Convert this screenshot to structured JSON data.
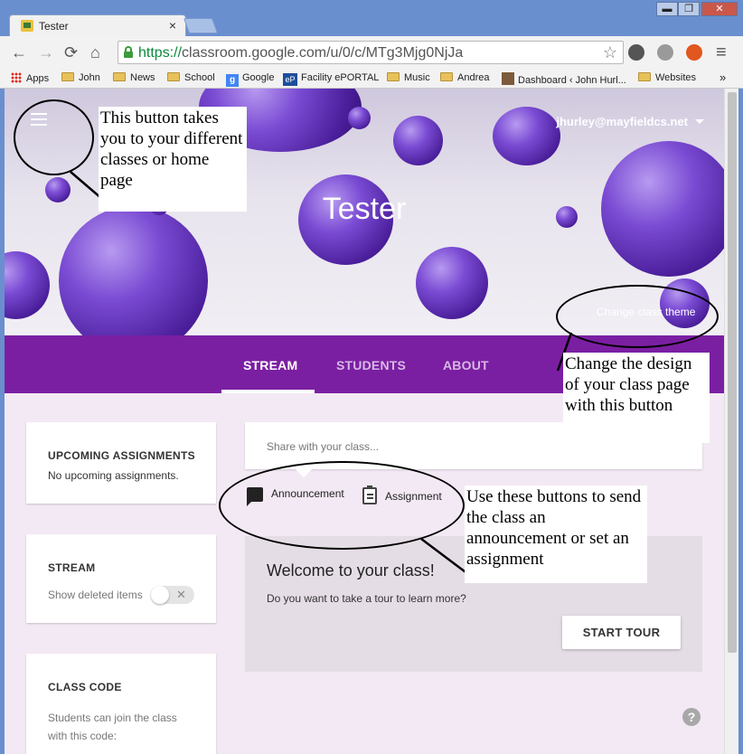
{
  "browser": {
    "tab_title": "Tester",
    "tab_close": "×",
    "url_scheme": "https://",
    "url_rest": "classroom.google.com/u/0/c/MTg3Mjg0NjJa",
    "window_minimize": "▬",
    "window_maximize": "❐",
    "window_close": "✕",
    "back_icon": "←",
    "forward_icon": "→",
    "reload_icon": "⟳",
    "home_icon": "⌂",
    "star_icon": "☆",
    "menu_icon": "≡",
    "bookmarks_overflow": "»"
  },
  "bookmarks": [
    {
      "label": "Apps",
      "icon": "apps-grid-icon"
    },
    {
      "label": "John",
      "icon": "folder-icon"
    },
    {
      "label": "News",
      "icon": "folder-icon"
    },
    {
      "label": "School",
      "icon": "folder-icon"
    },
    {
      "label": "Google",
      "icon": "google-icon",
      "icon_text": "g"
    },
    {
      "label": "Facility ePORTAL",
      "icon": "eportal-icon",
      "icon_text": "eP"
    },
    {
      "label": "Music",
      "icon": "folder-icon"
    },
    {
      "label": "Andrea",
      "icon": "folder-icon"
    },
    {
      "label": "Dashboard ‹ John Hurl...",
      "icon": "dashboard-icon"
    },
    {
      "label": "Websites",
      "icon": "folder-icon"
    }
  ],
  "header": {
    "account": "jhurley@mayfieldcs.net",
    "class_title": "Tester",
    "change_theme": "Change class theme"
  },
  "nav_tabs": [
    {
      "label": "STREAM",
      "active": true
    },
    {
      "label": "STUDENTS",
      "active": false
    },
    {
      "label": "ABOUT",
      "active": false
    }
  ],
  "sidebar": {
    "upcoming_title": "UPCOMING ASSIGNMENTS",
    "upcoming_text": "No upcoming assignments.",
    "stream_title": "STREAM",
    "stream_toggle_label": "Show deleted items",
    "toggle_x": "✕",
    "class_code_title": "CLASS CODE",
    "class_code_line1": "Students can join the class",
    "class_code_line2": "with this code:"
  },
  "stream": {
    "share_placeholder": "Share with your class...",
    "announcement_label": "Announcement",
    "assignment_label": "Assignment",
    "welcome_title": "Welcome to your class!",
    "welcome_text": "Do you want to take a tour to learn more?",
    "tour_button": "START TOUR",
    "help": "?"
  },
  "annotations": {
    "menu_note": "This button takes you to your different classes or home page",
    "theme_note": "Change the design of your class page with this button",
    "buttons_note": "Use these buttons to send the class an announcement or set an assignment"
  },
  "colors": {
    "tab_bar": "#7b1fa2",
    "content_bg": "#f3e9f4",
    "welcome_bg": "#e5dde6",
    "chrome_blue": "#6a8fce",
    "url_green": "#0a8a3a"
  }
}
